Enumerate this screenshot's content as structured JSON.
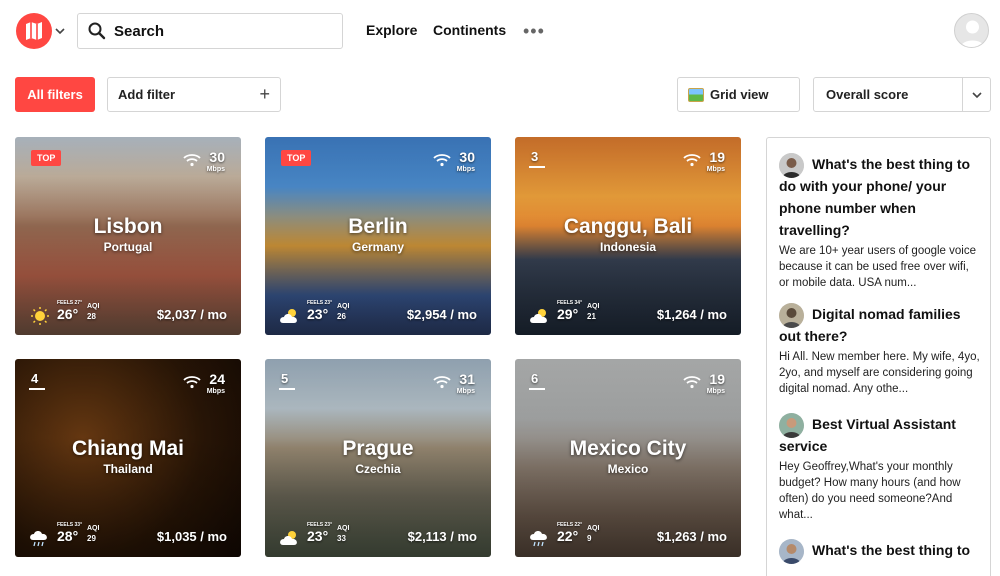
{
  "header": {
    "search_label": "Search",
    "nav": [
      "Explore",
      "Continents"
    ],
    "more": "•••"
  },
  "filters": {
    "all_filters": "All filters",
    "add_filter": "Add filter",
    "add_icon": "+",
    "grid_view": "Grid view",
    "sort": "Overall score"
  },
  "cards": [
    {
      "city": "Lisbon",
      "country": "Portugal",
      "badge": "TOP",
      "rank": "",
      "mbps": "30",
      "mbps_unit": "Mbps",
      "feels": "FEELS 27°",
      "temp": "26°",
      "aqi_label": "AQI",
      "aqi": "28",
      "cost": "$2,037 / mo",
      "weather": "sun-icon"
    },
    {
      "city": "Berlin",
      "country": "Germany",
      "badge": "TOP",
      "rank": "",
      "mbps": "30",
      "mbps_unit": "Mbps",
      "feels": "FEELS 23°",
      "temp": "23°",
      "aqi_label": "AQI",
      "aqi": "26",
      "cost": "$2,954 / mo",
      "weather": "cloud-icon"
    },
    {
      "city": "Canggu, Bali",
      "country": "Indonesia",
      "badge": "",
      "rank": "3",
      "mbps": "19",
      "mbps_unit": "Mbps",
      "feels": "FEELS 34°",
      "temp": "29°",
      "aqi_label": "AQI",
      "aqi": "21",
      "cost": "$1,264 / mo",
      "weather": "cloud-icon"
    },
    {
      "city": "Chiang Mai",
      "country": "Thailand",
      "badge": "",
      "rank": "4",
      "mbps": "24",
      "mbps_unit": "Mbps",
      "feels": "FEELS 33°",
      "temp": "28°",
      "aqi_label": "AQI",
      "aqi": "29",
      "cost": "$1,035 / mo",
      "weather": "rain-icon"
    },
    {
      "city": "Prague",
      "country": "Czechia",
      "badge": "",
      "rank": "5",
      "mbps": "31",
      "mbps_unit": "Mbps",
      "feels": "FEELS 23°",
      "temp": "23°",
      "aqi_label": "AQI",
      "aqi": "33",
      "cost": "$2,113 / mo",
      "weather": "cloud-icon"
    },
    {
      "city": "Mexico City",
      "country": "Mexico",
      "badge": "",
      "rank": "6",
      "mbps": "19",
      "mbps_unit": "Mbps",
      "feels": "FEELS 22°",
      "temp": "22°",
      "aqi_label": "AQI",
      "aqi": "9",
      "cost": "$1,263 / mo",
      "weather": "rain-icon"
    }
  ],
  "forum": [
    {
      "title": "What's the best thing to do with your phone/ your phone number when travelling?",
      "body": "We are 10+ year users of google voice because it can be used free over wifi, or mobile data. USA num..."
    },
    {
      "title": "Digital nomad families out there?",
      "body": "Hi All. New member here. My wife, 4yo, 2yo, and myself are considering going digital nomad. Any othe..."
    },
    {
      "title": "Best Virtual Assistant service",
      "body": "Hey Geoffrey,What's your monthly budget? How many hours (and how often) do you need someone?And what..."
    },
    {
      "title": "What's the best thing to",
      "body": ""
    }
  ],
  "colors": {
    "accent": "#ff4742"
  }
}
